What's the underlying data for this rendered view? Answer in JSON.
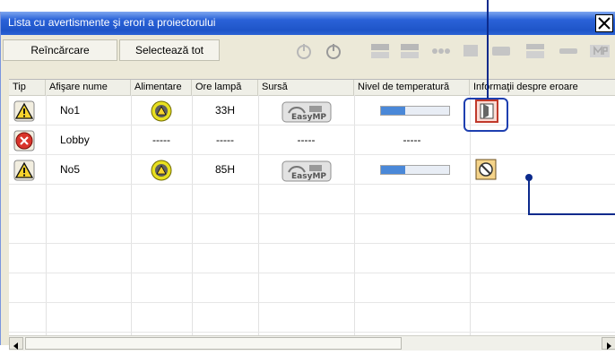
{
  "window": {
    "title": "Lista cu avertismente şi erori a proiectorului"
  },
  "toolbar": {
    "reload_label": "Reîncărcare",
    "select_all_label": "Selectează tot"
  },
  "columns": [
    "Tip",
    "Afişare nume",
    "Alimentare",
    "Ore lampă",
    "Sursă",
    "Nivel de temperatură",
    "Informaţii despre eroare"
  ],
  "rows": [
    {
      "type_icon": "warning-icon",
      "name": "No1",
      "power_icon": "lamp-warning-icon",
      "lamp_hours": "33H",
      "source_icon": "easymp-icon",
      "temperature": 0.35,
      "error_icon": "lamp-cover-error-icon"
    },
    {
      "type_icon": "error-icon",
      "name": "Lobby",
      "power": "-----",
      "lamp_hours": "-----",
      "source": "-----",
      "temperature_text": "-----"
    },
    {
      "type_icon": "warning-icon",
      "name": "No5",
      "power_icon": "lamp-warning-icon",
      "lamp_hours": "85H",
      "source_icon": "easymp-icon",
      "temperature": 0.35,
      "error_icon": "filter-error-icon"
    }
  ],
  "colors": {
    "titlebar": "#245edb",
    "callout": "#1e3fb0",
    "warning": "#f6d32d",
    "error": "#d9342b"
  }
}
